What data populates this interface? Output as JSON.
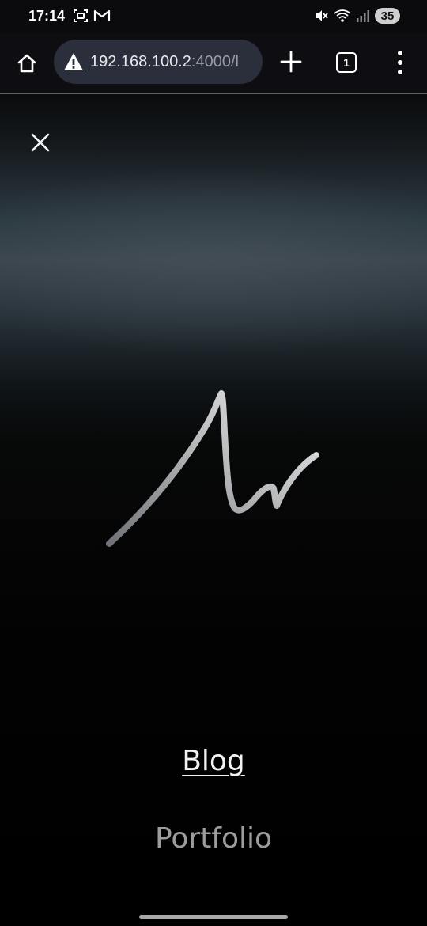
{
  "status_bar": {
    "time": "17:14",
    "battery": "35",
    "left_icons": [
      "screenshot-icon",
      "gmail-icon"
    ],
    "right_icons": [
      "mute-icon",
      "wifi-icon",
      "signal-icon"
    ]
  },
  "browser": {
    "url_host": "192.168.100.2",
    "url_rest": ":4000/l",
    "tab_count": "1",
    "icons": {
      "home": "home-icon",
      "warning": "warning-icon",
      "new_tab": "plus-icon",
      "menu": "more-vert-icon"
    }
  },
  "page": {
    "close_icon": "close-icon",
    "logo": "signature-logo",
    "nav": {
      "blog": "Blog",
      "portfolio": "Portfolio"
    }
  },
  "colors": {
    "url_bar_bg": "#2b2e3b",
    "nav_active": "#f2f2f2",
    "nav_inactive": "#9c9c9c"
  }
}
